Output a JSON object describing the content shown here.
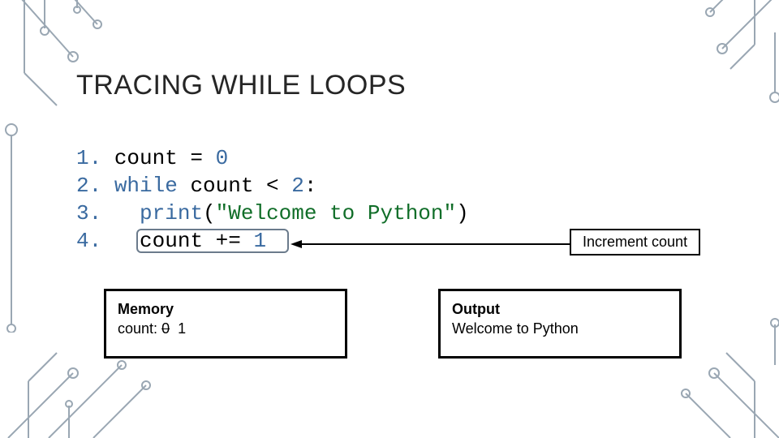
{
  "title": "TRACING WHILE LOOPS",
  "code": {
    "lines": [
      {
        "n": "1.",
        "indent": "",
        "tokens": [
          {
            "t": "count",
            "c": "id"
          },
          {
            "t": " = ",
            "c": "id"
          },
          {
            "t": "0",
            "c": "lit"
          }
        ]
      },
      {
        "n": "2.",
        "indent": "",
        "tokens": [
          {
            "t": "while ",
            "c": "kw"
          },
          {
            "t": "count",
            "c": "id"
          },
          {
            "t": " < ",
            "c": "id"
          },
          {
            "t": "2",
            "c": "lit"
          },
          {
            "t": ":",
            "c": "id"
          }
        ]
      },
      {
        "n": "3.",
        "indent": "  ",
        "tokens": [
          {
            "t": "print",
            "c": "kw"
          },
          {
            "t": "(",
            "c": "id"
          },
          {
            "t": "\"Welcome to Python\"",
            "c": "str"
          },
          {
            "t": ")",
            "c": "id"
          }
        ]
      },
      {
        "n": "4.",
        "indent": "  ",
        "tokens": [
          {
            "t": "count",
            "c": "id"
          },
          {
            "t": " += ",
            "c": "id"
          },
          {
            "t": "1",
            "c": "lit"
          }
        ]
      }
    ]
  },
  "callout": "Increment count",
  "memory": {
    "header": "Memory",
    "label": "count:",
    "old": "0",
    "new": "1"
  },
  "output": {
    "header": "Output",
    "line1": "Welcome to Python"
  }
}
